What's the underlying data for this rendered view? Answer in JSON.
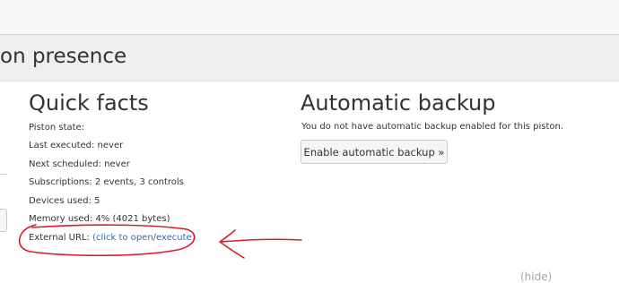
{
  "page": {
    "title": "on presence"
  },
  "quick_facts": {
    "heading": "Quick facts",
    "piston_state_label": "Piston state:",
    "last_executed": "Last executed: never",
    "next_scheduled": "Next scheduled: never",
    "subscriptions": "Subscriptions: 2 events, 3 controls",
    "devices_used": "Devices used: 5",
    "memory_used": "Memory used: 4% (4021 bytes)",
    "external_url_label": "External URL:",
    "external_url_link": "(click to open/execute)"
  },
  "automatic_backup": {
    "heading": "Automatic backup",
    "description": "You do not have automatic backup enabled for this piston.",
    "enable_button": "Enable automatic backup »"
  },
  "hide_link": "(hide)",
  "annotation": {
    "color": "#d81e2a"
  }
}
